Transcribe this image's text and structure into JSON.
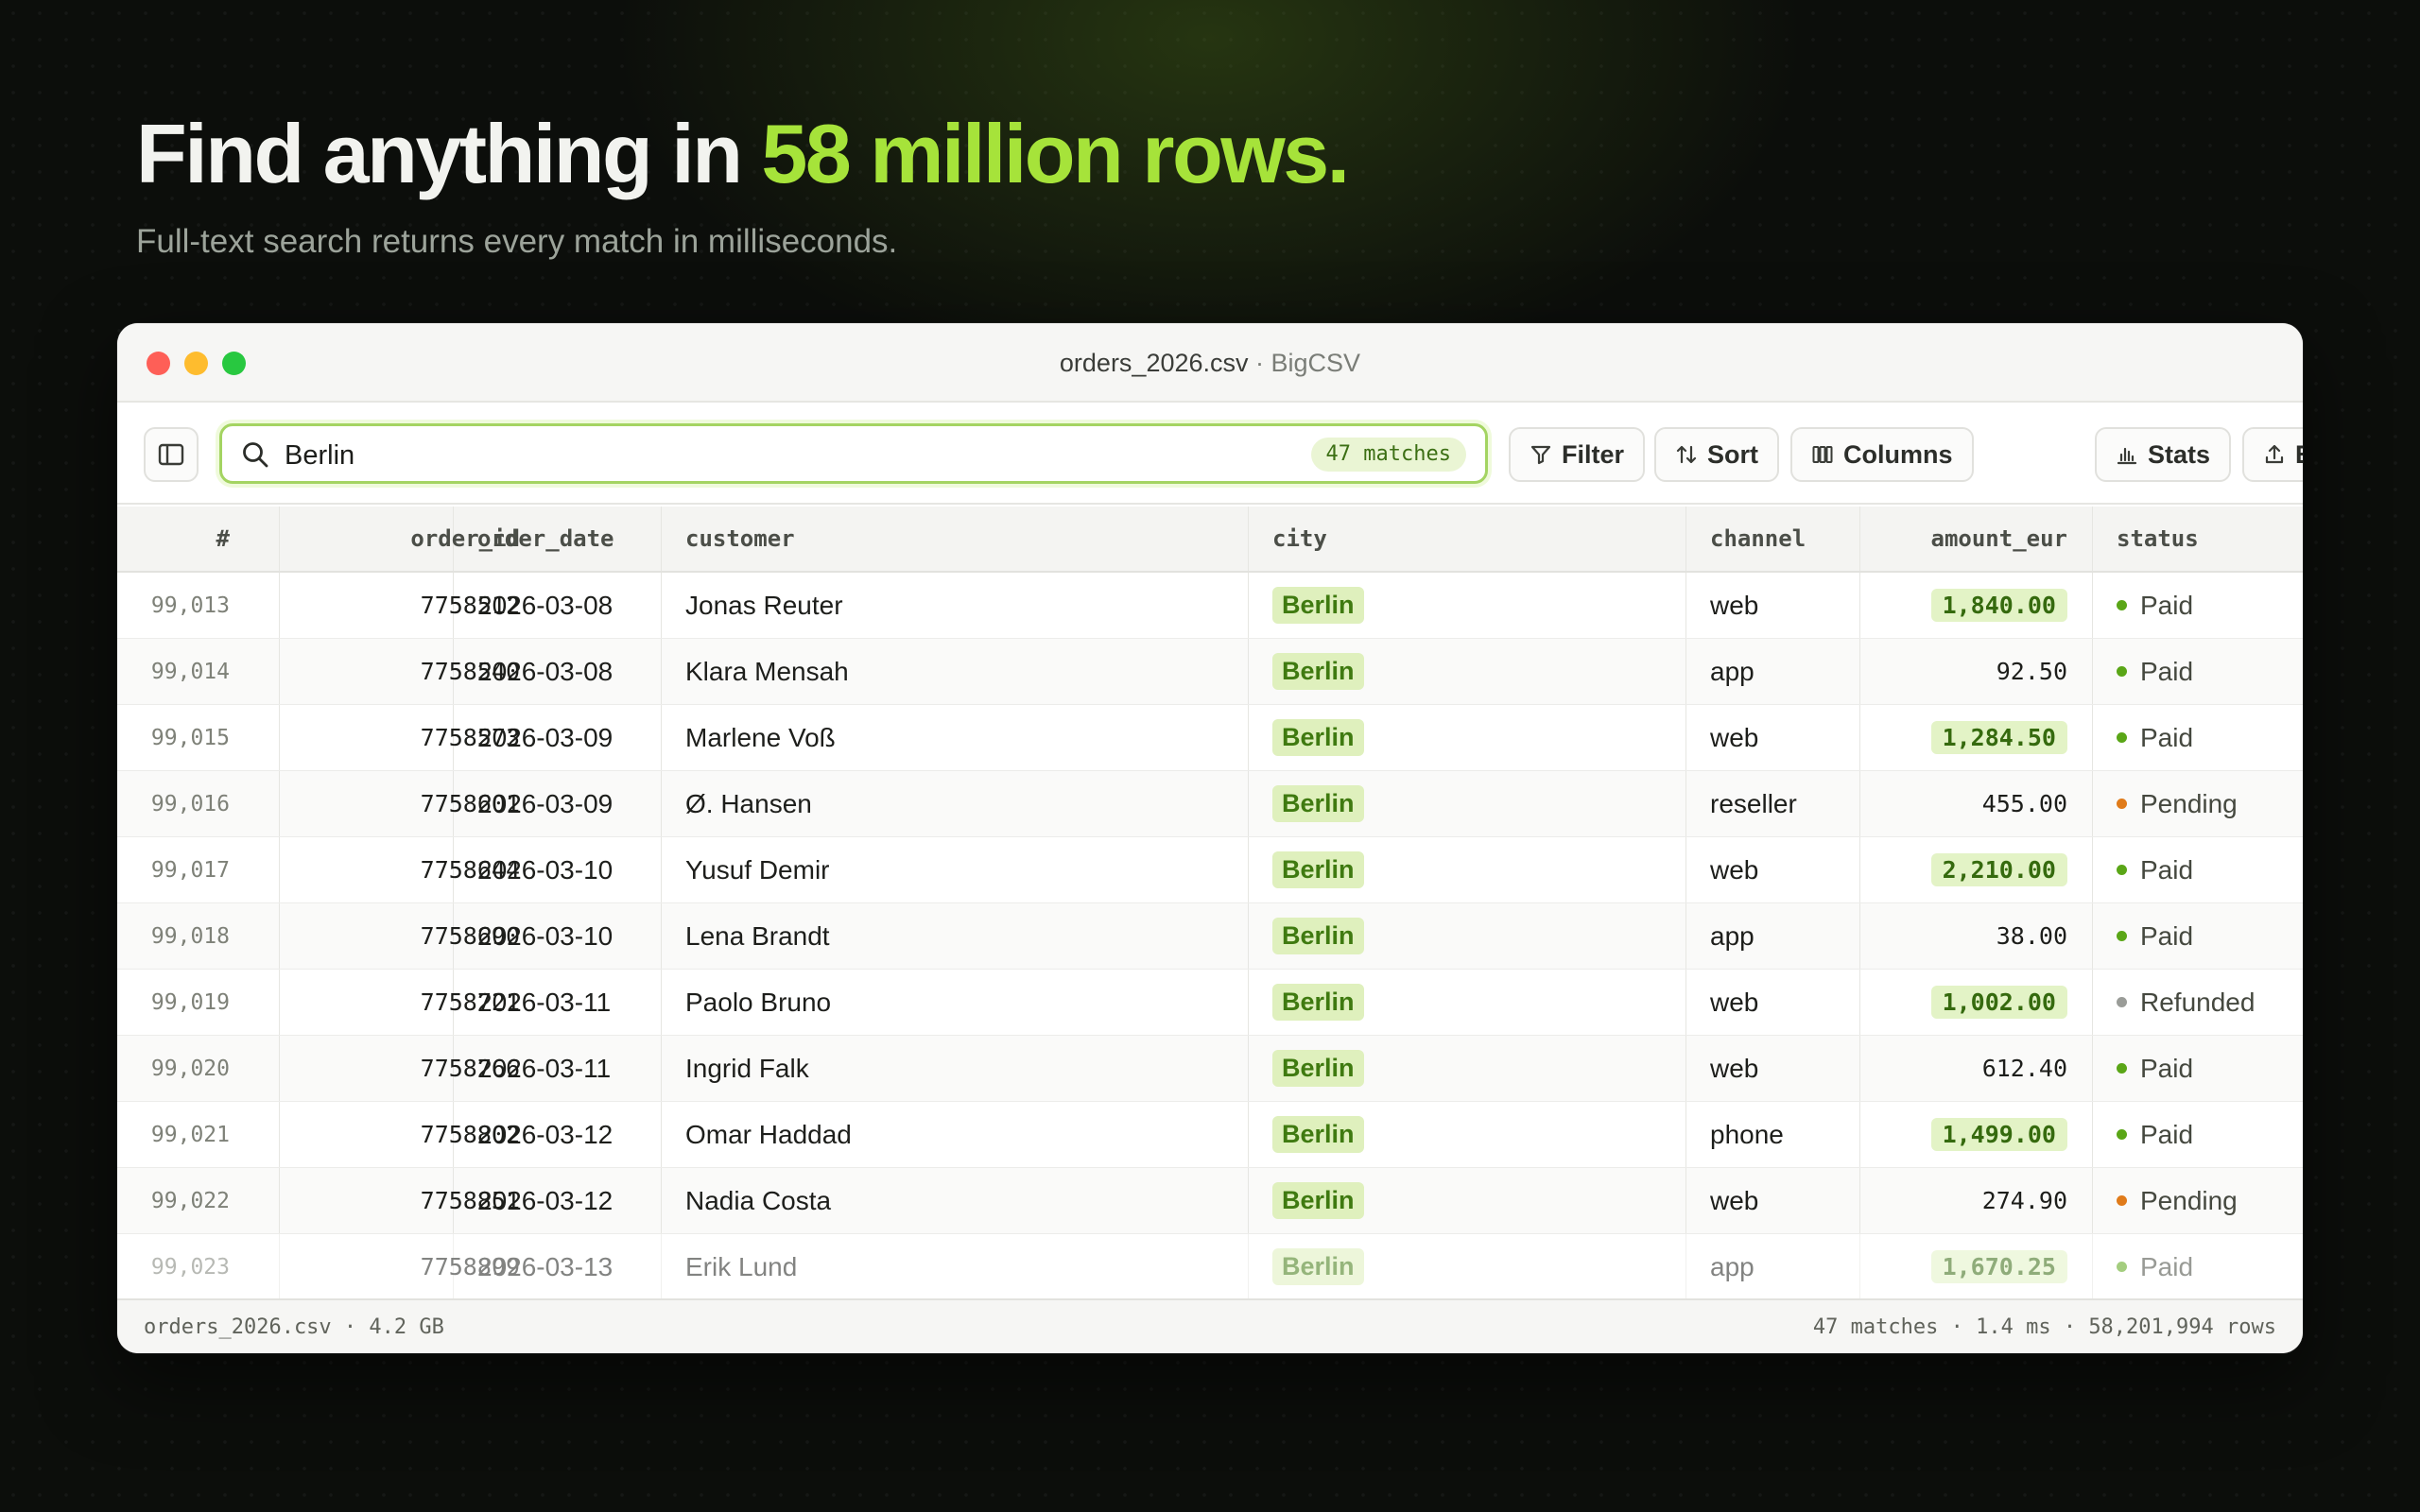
{
  "hero": {
    "title_prefix": "Find anything in ",
    "title_accent": "58 million rows.",
    "subtitle": "Full-text search returns every match in milliseconds."
  },
  "window": {
    "file": "orders_2026.csv",
    "separator": " · ",
    "app": "BigCSV"
  },
  "toolbar": {
    "search_value": "Berlin",
    "match_count": "47 matches",
    "filter_label": "Filter",
    "sort_label": "Sort",
    "columns_label": "Columns",
    "stats_label": "Stats",
    "export_label": "Export"
  },
  "table": {
    "headers": [
      "#",
      "order_id",
      "order_date",
      "customer",
      "city",
      "channel",
      "amount_eur",
      "status"
    ],
    "rows": [
      {
        "idx": "99,013",
        "order_id": "7758512",
        "date": "2026-03-08",
        "customer": "Jonas Reuter",
        "city": "Berlin",
        "channel": "web",
        "amount": "1,840.00",
        "amount_highlight": true,
        "status": "Paid",
        "status_color": "#5aa617"
      },
      {
        "idx": "99,014",
        "order_id": "7758540",
        "date": "2026-03-08",
        "customer": "Klara Mensah",
        "city": "Berlin",
        "channel": "app",
        "amount": "92.50",
        "amount_highlight": false,
        "status": "Paid",
        "status_color": "#5aa617"
      },
      {
        "idx": "99,015",
        "order_id": "7758573",
        "date": "2026-03-09",
        "customer": "Marlene Voß",
        "city": "Berlin",
        "channel": "web",
        "amount": "1,284.50",
        "amount_highlight": true,
        "status": "Paid",
        "status_color": "#5aa617"
      },
      {
        "idx": "99,016",
        "order_id": "7758601",
        "date": "2026-03-09",
        "customer": "Ø. Hansen",
        "city": "Berlin",
        "channel": "reseller",
        "amount": "455.00",
        "amount_highlight": false,
        "status": "Pending",
        "status_color": "#e07b1a"
      },
      {
        "idx": "99,017",
        "order_id": "7758644",
        "date": "2026-03-10",
        "customer": "Yusuf Demir",
        "city": "Berlin",
        "channel": "web",
        "amount": "2,210.00",
        "amount_highlight": true,
        "status": "Paid",
        "status_color": "#5aa617"
      },
      {
        "idx": "99,018",
        "order_id": "7758690",
        "date": "2026-03-10",
        "customer": "Lena Brandt",
        "city": "Berlin",
        "channel": "app",
        "amount": "38.00",
        "amount_highlight": false,
        "status": "Paid",
        "status_color": "#5aa617"
      },
      {
        "idx": "99,019",
        "order_id": "7758721",
        "date": "2026-03-11",
        "customer": "Paolo Bruno",
        "city": "Berlin",
        "channel": "web",
        "amount": "1,002.00",
        "amount_highlight": true,
        "status": "Refunded",
        "status_color": "#9a9c98"
      },
      {
        "idx": "99,020",
        "order_id": "7758766",
        "date": "2026-03-11",
        "customer": "Ingrid Falk",
        "city": "Berlin",
        "channel": "web",
        "amount": "612.40",
        "amount_highlight": false,
        "status": "Paid",
        "status_color": "#5aa617"
      },
      {
        "idx": "99,021",
        "order_id": "7758802",
        "date": "2026-03-12",
        "customer": "Omar Haddad",
        "city": "Berlin",
        "channel": "phone",
        "amount": "1,499.00",
        "amount_highlight": true,
        "status": "Paid",
        "status_color": "#5aa617"
      },
      {
        "idx": "99,022",
        "order_id": "7758851",
        "date": "2026-03-12",
        "customer": "Nadia Costa",
        "city": "Berlin",
        "channel": "web",
        "amount": "274.90",
        "amount_highlight": false,
        "status": "Pending",
        "status_color": "#e07b1a"
      },
      {
        "idx": "99,023",
        "order_id": "7758899",
        "date": "2026-03-13",
        "customer": "Erik Lund",
        "city": "Berlin",
        "channel": "app",
        "amount": "1,670.25",
        "amount_highlight": true,
        "status": "Paid",
        "status_color": "#5aa617"
      }
    ]
  },
  "statusbar": {
    "left": "orders_2026.csv · 4.2 GB",
    "right": "47 matches · 1.4 ms · 58,201,994 rows"
  },
  "colors": {
    "accent": "#a6e33a",
    "paid": "#5aa617",
    "pending": "#e07b1a",
    "refunded": "#9a9c98"
  }
}
